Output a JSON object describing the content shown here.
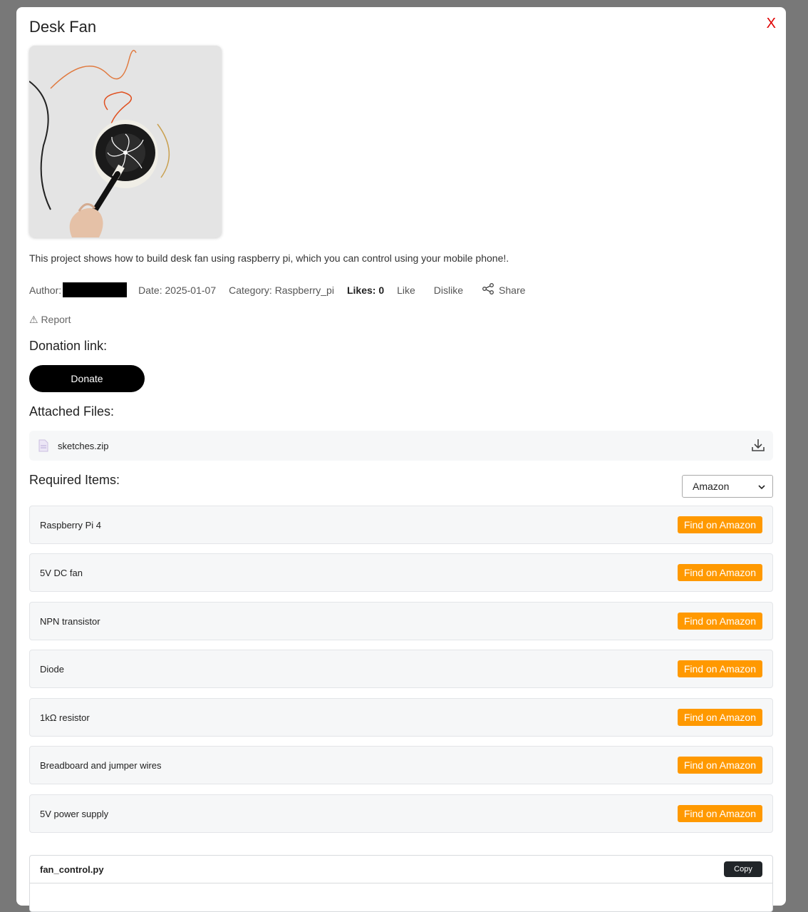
{
  "modal": {
    "close_label": "X",
    "title": "Desk Fan",
    "description": "This project shows how to build desk fan using raspberry pi, which you can control using your mobile phone!.",
    "meta": {
      "author_label": "Author:",
      "date": "Date: 2025-01-07",
      "category": "Category: Raspberry_pi",
      "likes": "Likes: 0",
      "like_label": "Like",
      "dislike_label": "Dislike",
      "share_label": "Share"
    },
    "report_label": "⚠ Report",
    "donation": {
      "heading": "Donation link:",
      "button_label": "Donate"
    },
    "files": {
      "heading": "Attached Files:",
      "items": [
        {
          "name": "sketches.zip"
        }
      ]
    },
    "required": {
      "heading": "Required Items:",
      "store_selected": "Amazon",
      "items": [
        {
          "name": "Raspberry Pi 4",
          "action": "Find on Amazon"
        },
        {
          "name": "5V DC fan",
          "action": "Find on Amazon"
        },
        {
          "name": "NPN transistor",
          "action": "Find on Amazon"
        },
        {
          "name": "Diode",
          "action": "Find on Amazon"
        },
        {
          "name": "1kΩ resistor",
          "action": "Find on Amazon"
        },
        {
          "name": "Breadboard and jumper wires",
          "action": "Find on Amazon"
        },
        {
          "name": "5V power supply",
          "action": "Find on Amazon"
        }
      ]
    },
    "code": {
      "filename": "fan_control.py",
      "copy_label": "Copy"
    }
  },
  "colors": {
    "overlay": "#787878",
    "amazon_orange": "#ff9900",
    "close_red": "#e00000"
  }
}
